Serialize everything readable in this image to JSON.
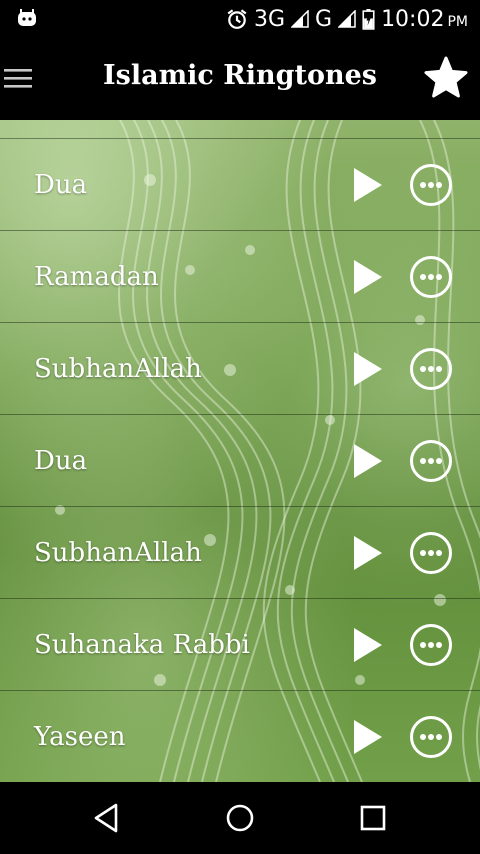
{
  "status_bar": {
    "network_3g": "3G",
    "network_g": "G",
    "time": "10:02",
    "ampm": "PM",
    "icons": [
      "android-notification-icon",
      "alarm-icon",
      "signal-icon",
      "battery-charging-icon"
    ]
  },
  "app_bar": {
    "title": "Islamic Ringtones",
    "menu_icon": "hamburger-menu-icon",
    "favorite_icon": "star-icon"
  },
  "list": {
    "items": [
      {
        "title": "Dua"
      },
      {
        "title": "Ramadan"
      },
      {
        "title": "SubhanAllah"
      },
      {
        "title": "Dua"
      },
      {
        "title": "SubhanAllah"
      },
      {
        "title": "Suhanaka Rabbi"
      },
      {
        "title": "Yaseen"
      }
    ],
    "row_icons": [
      "play-icon",
      "more-options-icon"
    ]
  },
  "nav_bar": {
    "icons": [
      "back-icon",
      "home-icon",
      "recents-icon"
    ]
  },
  "colors": {
    "bar_background": "#000000",
    "text": "#ffffff",
    "list_green": "#6e9a45"
  }
}
